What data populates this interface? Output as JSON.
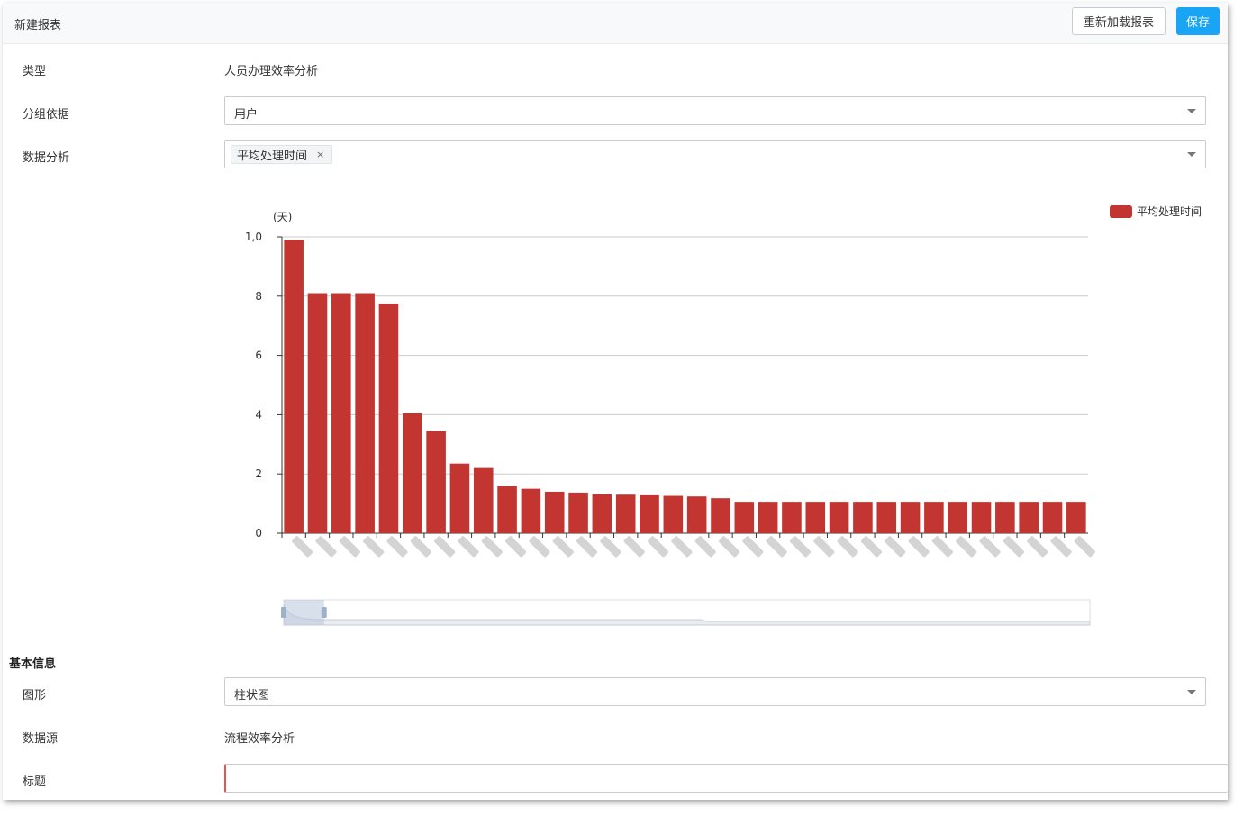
{
  "header": {
    "title": "新建报表",
    "reload_label": "重新加载报表",
    "save_label": "保存"
  },
  "form": {
    "type_label": "类型",
    "type_value": "人员办理效率分析",
    "group_label": "分组依据",
    "group_value": "用户",
    "analysis_label": "数据分析",
    "analysis_tag": "平均处理时间",
    "analysis_tag_remove": "×"
  },
  "basic": {
    "section_title": "基本信息",
    "shape_label": "图形",
    "shape_value": "柱状图",
    "source_label": "数据源",
    "source_value": "流程效率分析",
    "title_label": "标题",
    "title_value": ""
  },
  "chart_data": {
    "type": "bar",
    "title": "",
    "unit_label": "(天)",
    "ylim": [
      0,
      10
    ],
    "yticks": [
      "0",
      "2",
      "4",
      "6",
      "8",
      "1,0"
    ],
    "grid": true,
    "legend": {
      "placement": "top-right",
      "entries": [
        "平均处理时间"
      ]
    },
    "series": [
      {
        "name": "平均处理时间",
        "color": "#c23531",
        "values": [
          9.9,
          8.1,
          8.1,
          8.1,
          7.75,
          4.05,
          3.45,
          2.35,
          2.2,
          1.58,
          1.5,
          1.4,
          1.37,
          1.32,
          1.3,
          1.28,
          1.26,
          1.24,
          1.18,
          1.06,
          1.06,
          1.06,
          1.06,
          1.06,
          1.06,
          1.06,
          1.06,
          1.06,
          1.06,
          1.06,
          1.06,
          1.06,
          1.06,
          1.06
        ]
      }
    ],
    "categories": [
      "",
      "",
      "",
      "",
      "",
      "",
      "",
      "",
      "",
      "",
      "",
      "",
      "",
      "",
      "",
      "",
      "",
      "",
      "",
      "",
      "",
      "",
      "",
      "",
      "",
      "",
      "",
      "",
      "",
      "",
      "",
      "",
      "",
      ""
    ],
    "zoom": {
      "start": 0,
      "end": 0.05
    }
  }
}
